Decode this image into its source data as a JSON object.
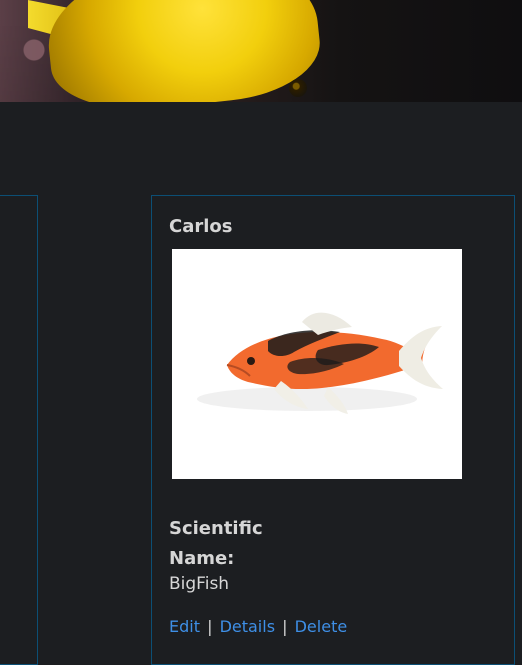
{
  "card": {
    "name": "Carlos",
    "scientific_name_label": "Scientific Name:",
    "scientific_name_value": "BigFish",
    "actions": {
      "edit": "Edit",
      "details": "Details",
      "delete": "Delete",
      "separator": "|"
    }
  },
  "colors": {
    "background": "#1c1e21",
    "border": "#0c4f75",
    "link": "#3e8fe6",
    "text": "#d7d7d7"
  }
}
